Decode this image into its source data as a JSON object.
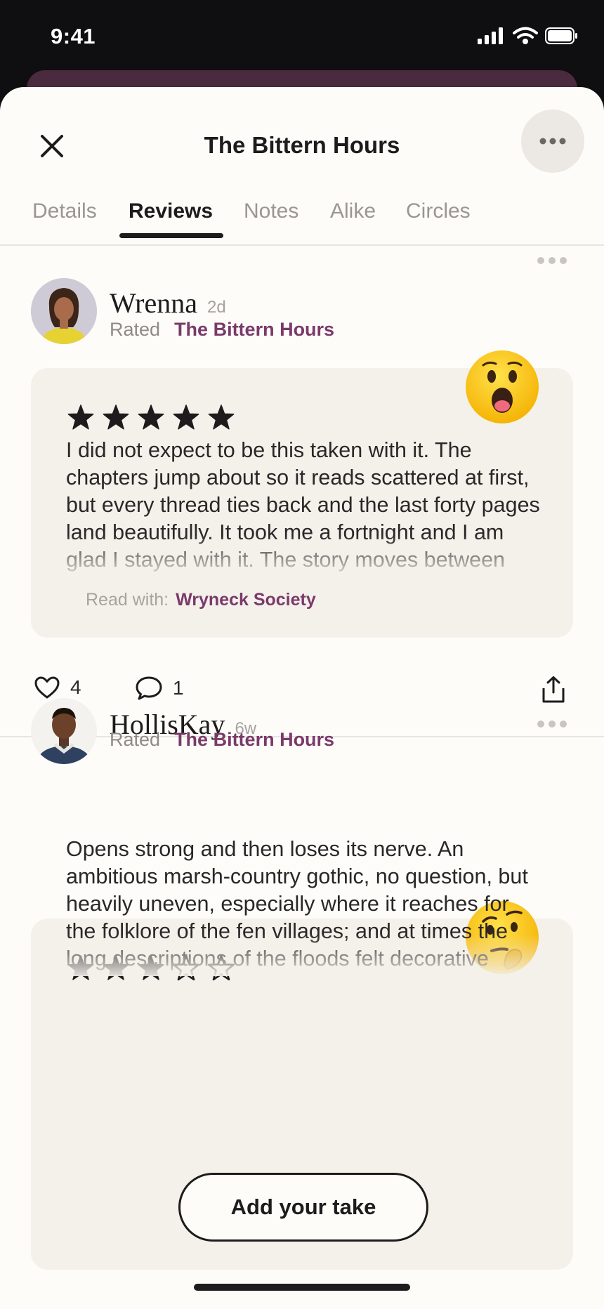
{
  "status_bar": {
    "time": "9:41"
  },
  "header": {
    "title": "The Bittern Hours"
  },
  "tabs": [
    {
      "label": "Details"
    },
    {
      "label": "Reviews"
    },
    {
      "label": "Notes"
    },
    {
      "label": "Alike"
    },
    {
      "label": "Circles"
    }
  ],
  "reviews": [
    {
      "name": "Wrenna",
      "age": "2d",
      "rated_label": "Rated",
      "book": "The Bittern Hours",
      "rating": 5,
      "reaction_icon": "astonished-emoji-icon",
      "text": "I did not expect to be this taken with it. The chapters jump about so it reads scattered at first, but every thread ties back and the last forty pages land beautifully. It took me a fortnight and I am glad I stayed with it. The story moves between three winters on the",
      "read_with_label": "Read with:",
      "read_with": "Wryneck Society",
      "likes": "4",
      "comments": "1"
    },
    {
      "name": "HollisKay",
      "age": "6w",
      "rated_label": "Rated",
      "book": "The Bittern Hours",
      "rating": 3,
      "reaction_icon": "skeptical-emoji-icon",
      "text": "Opens strong and then loses its nerve. An ambitious marsh-country gothic, no question, but heavily uneven, especially where it reaches for the folklore of the fen villages; and at times the long descriptions of the floods felt decorative rather than"
    }
  ],
  "cta": {
    "label": "Add your take"
  },
  "colors": {
    "accent": "#7a3a6a",
    "sheet_bg": "#fdfcf8",
    "card_bg": "#f4f1eb",
    "ink": "#1d1b1c"
  }
}
